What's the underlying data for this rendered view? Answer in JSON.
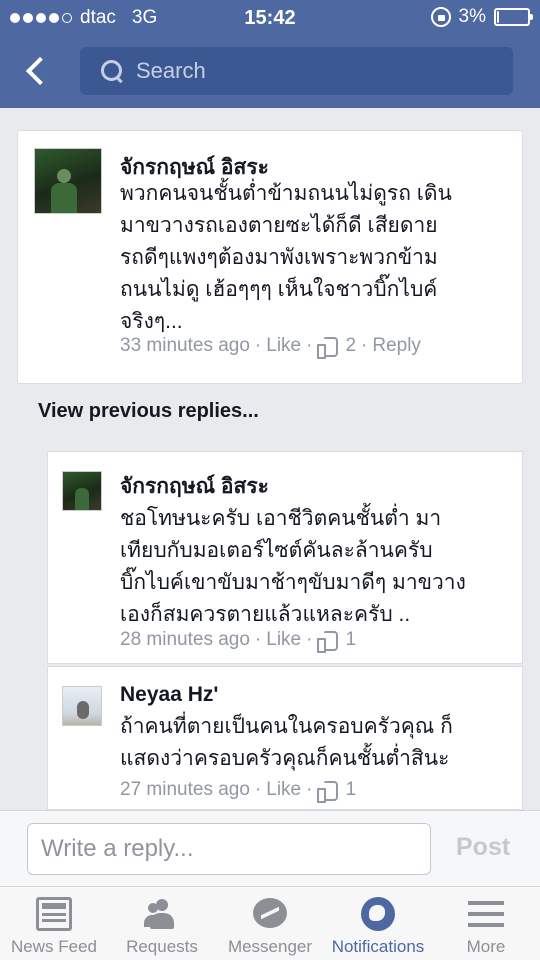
{
  "status_bar": {
    "carrier": "dtac",
    "network": "3G",
    "time": "15:42",
    "battery": "3%",
    "battery_level": 0.03
  },
  "search": {
    "placeholder": "Search"
  },
  "comment": {
    "author": "จักรกฤษณ์ อิสระ",
    "text": "พวกคนจนชั้นต่ำข้ามถนนไม่ดูรถ เดิน\nมาขวางรถเองตายซะได้ก็ดี เสียดาย\nรถดีๆแพงๆต้องมาพังเพราะพวกข้าม\nถนนไม่ดู เฮ้อๆๆๆ เห็นใจชาวบิ๊กไบค์\nจริงๆ...",
    "time": "33 minutes ago",
    "like_label": "Like",
    "like_count": "2",
    "reply_label": "Reply"
  },
  "view_previous": "View previous replies...",
  "replies": [
    {
      "author": "จักรกฤษณ์ อิสระ",
      "text": "ชอโทษนะครับ เอาชีวิตคนชั้นต่ำ มา\nเทียบกับมอเตอร์ไซต์คันละล้านครับ\nบิ๊กไบค์เขาขับมาช้าๆขับมาดีๆ มาขวาง\nเองก็สมควรตายแล้วแหละครับ ..",
      "time": "28 minutes ago",
      "like_label": "Like",
      "like_count": "1"
    },
    {
      "author": "Neyaa Hz'",
      "text": "ถ้าคนที่ตายเป็นคนในครอบครัวคุณ ก็\nแสดงว่าครอบครัวคุณก็คนชั้นต่ำสินะ",
      "time": "27 minutes ago",
      "like_label": "Like",
      "like_count": "1"
    }
  ],
  "composer": {
    "placeholder": "Write a reply...",
    "post_label": "Post"
  },
  "tabs": [
    {
      "label": "News Feed",
      "icon": "news-feed-icon"
    },
    {
      "label": "Requests",
      "icon": "friend-requests-icon"
    },
    {
      "label": "Messenger",
      "icon": "messenger-icon"
    },
    {
      "label": "Notifications",
      "icon": "globe-icon"
    },
    {
      "label": "More",
      "icon": "menu-icon"
    }
  ],
  "colors": {
    "header": "#4e69a2",
    "search_bg": "#3b5893",
    "active_tab": "#4e69a2",
    "meta_text": "#9197a3"
  }
}
